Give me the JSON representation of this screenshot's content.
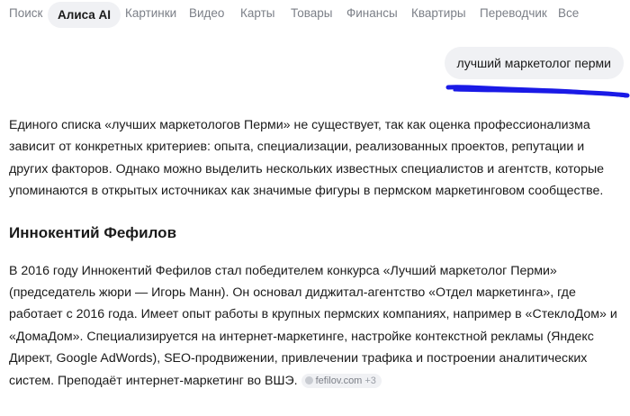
{
  "tabs": [
    {
      "label": "Поиск",
      "active": false
    },
    {
      "label": "Алиса AI",
      "active": true
    },
    {
      "label": "Картинки",
      "active": false
    },
    {
      "label": "Видео",
      "active": false
    },
    {
      "label": "Карты",
      "active": false
    },
    {
      "label": "Товары",
      "active": false
    },
    {
      "label": "Финансы",
      "active": false
    },
    {
      "label": "Квартиры",
      "active": false
    },
    {
      "label": "Переводчик",
      "active": false
    },
    {
      "label": "Все",
      "active": false
    }
  ],
  "query": {
    "text": "лучший маркетолог перми"
  },
  "answer": {
    "intro": "Единого списка «лучших маркетологов Перми» не существует, так как оценка профессионализма зависит от конкретных критериев: опыта, специализации, реализованных проектов, репутации и других факторов. Однако можно выделить нескольких известных специалистов и агентств, которые упоминаются в открытых источниках как значимые фигуры в пермском маркетинговом сообществе.",
    "section_title": "Иннокентий Фефилов",
    "section_body": "В 2016 году Иннокентий Фефилов стал победителем конкурса «Лучший маркетолог Перми» (председатель жюри — Игорь Манн). Он основал диджитал-агентство «Отдел маркетинга», где работает с 2016 года. Имеет опыт работы в крупных пермских компаниях, например в «СтеклоДом» и «ДомаДом». Специализируется на интернет-маркетинге, настройке контекстной рекламы (Яндекс Директ, Google AdWords), SEO-продвижении, привлечении трафика и построении аналитических систем. Преподаёт интернет-маркетинг во ВШЭ.",
    "source": {
      "domain": "fefilov.com",
      "more": "+3"
    }
  },
  "colors": {
    "tab_inactive": "#7b7f87",
    "chip_background": "#f0f1f4",
    "scribble": "#1a1ae6",
    "text": "#1a1a1a"
  }
}
